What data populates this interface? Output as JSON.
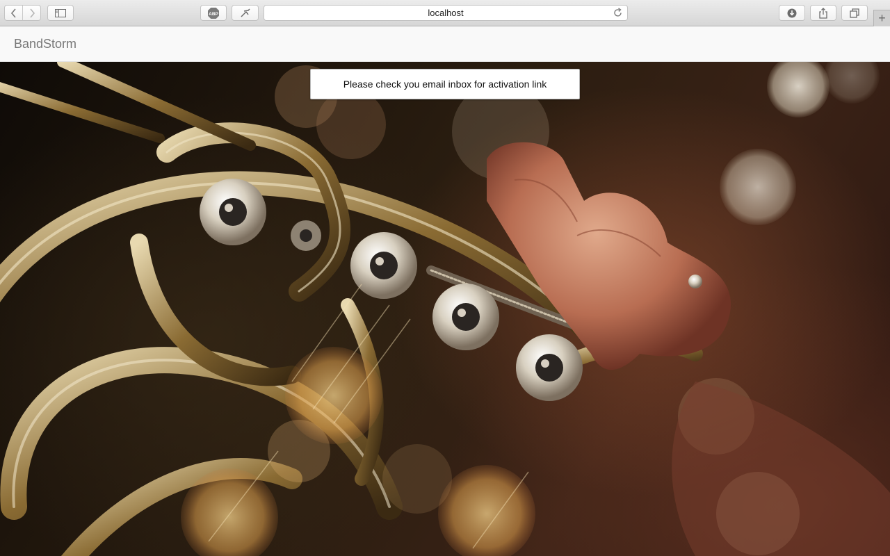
{
  "browser": {
    "url": "localhost",
    "icons": {
      "back": "chevron-left-icon",
      "forward": "chevron-right-icon",
      "sidebar": "sidebar-icon",
      "adblock": "adblock-icon",
      "tool": "pen-tool-icon",
      "reload": "reload-icon",
      "downloads": "download-icon",
      "share": "share-icon",
      "tabs": "tabs-overview-icon",
      "new_tab": "plus-icon"
    },
    "adblock_label": "ABP",
    "new_tab_symbol": "+"
  },
  "navbar": {
    "brand": "BandStorm"
  },
  "alert": {
    "message": "Please check you email inbox for activation link"
  },
  "hero": {
    "image_subject": "french-horn-photo"
  },
  "colors": {
    "brand_text": "#777777",
    "navbar_bg": "#f9f9f9",
    "alert_bg": "#ffffff"
  }
}
